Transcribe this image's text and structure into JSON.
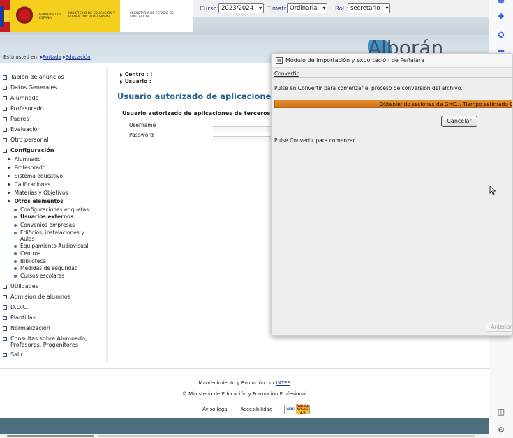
{
  "header": {
    "gov_text": "GOBIERNO DE ESPAÑA",
    "ministry_text": "MINISTERIO DE EDUCACIÓN Y FORMACIÓN PROFESIONAL",
    "secretary_text": "SECRETARÍA DE ESTADO DE EDUCACIÓN",
    "curso_label": "Curso:",
    "curso_value": "2023/2024",
    "tmatr_label": "T.matr.:",
    "tmatr_value": "Ordinaria",
    "rol_label": "Rol :",
    "rol_value": "secretario",
    "app_name": "Alborán"
  },
  "breadcrumb": {
    "prefix": "Está usted en:",
    "items": [
      "Portada",
      "Educación"
    ]
  },
  "sidebar": {
    "top_items": [
      "Tablón de anuncios",
      "Datos Generales",
      "Alumnado",
      "Profesorado",
      "Padres",
      "Evaluación",
      "Otro personal",
      "Configuración"
    ],
    "config_items": [
      "Alumnado",
      "Profesorado",
      "Sistema educativo",
      "Calificaciones",
      "Materias y Objetivos",
      "Otros elementos"
    ],
    "otros_items": [
      "Configuraciones etiquetas",
      "Usuarios externos",
      "Convenios empresas",
      "Edificios, instalaciones y Aulas",
      "Equipamiento Audiovisual",
      "Centros",
      "Biblioteca",
      "Medidas de seguridad",
      "Cursos escolares"
    ],
    "bottom_items": [
      "Utilidades",
      "Admisión de alumnos",
      "D.O.C.",
      "Plantillas",
      "Normalización",
      "Consultas sobre Alumnado, Profesores, Progenitores",
      "Salir"
    ]
  },
  "main": {
    "centro_label": "Centro : I",
    "usuario_label": "Usuario :",
    "page_title": "Usuario autorizado de aplicaciones de terceros",
    "form_title": "Usuario autorizado de aplicaciones de terceros",
    "username_label": "Username",
    "password_label": "Password"
  },
  "footer": {
    "maint_text": "Mantenimiento y Evolución por",
    "maint_link": "INTEF",
    "ministry": "© Ministerio de Educación y Formación Profesional",
    "legal": "Aviso legal",
    "access": "Accesibilidad",
    "badge_w3": "W3C",
    "badge_wai": "WAI-AA WCAG 2.0"
  },
  "dialog": {
    "title": "Módulo de importación y exportación de Peñalara",
    "menu": "Convertir",
    "instruction": "Pulse en Convertir para comenzar el proceso de conversión del archivo.",
    "progress_text": "Obteniendo sesiones de GHC... Tiempo estimado 0",
    "cancel": "Cancelar",
    "status": "Pulse Convertir para comenzar...",
    "previous": "Anterior"
  },
  "colors": {
    "accent_title": "#2a6591",
    "progress": "#e0862a",
    "link": "#1b2f8e"
  }
}
